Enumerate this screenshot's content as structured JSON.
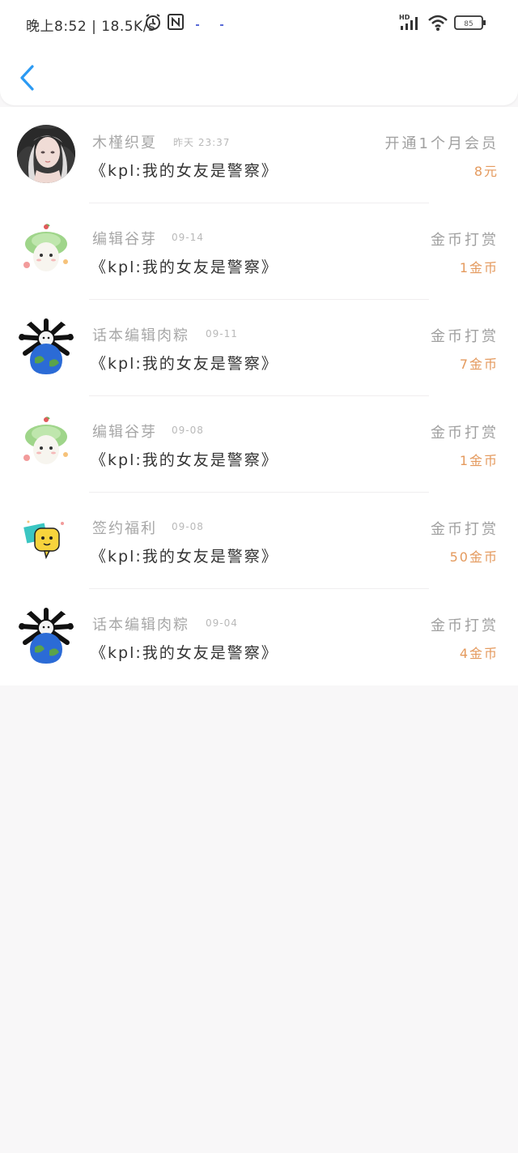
{
  "status_bar": {
    "time_and_speed": "晚上8:52 | 18.5K/s",
    "battery": "85",
    "network": "HD"
  },
  "nav": {
    "back_label": "‹"
  },
  "records": [
    {
      "name": "木槿织夏",
      "date": "昨天 23:37",
      "title": "《kpl:我的女友是警察》",
      "type": "开通1个月会员",
      "amount": "8元",
      "avatar": "portrait"
    },
    {
      "name": "编辑谷芽",
      "date": "09-14",
      "title": "《kpl:我的女友是警察》",
      "type": "金币打赏",
      "amount": "1金币",
      "avatar": "sprout"
    },
    {
      "name": "话本编辑肉粽",
      "date": "09-11",
      "title": "《kpl:我的女友是警察》",
      "type": "金币打赏",
      "amount": "7金币",
      "avatar": "earth"
    },
    {
      "name": "编辑谷芽",
      "date": "09-08",
      "title": "《kpl:我的女友是警察》",
      "type": "金币打赏",
      "amount": "1金币",
      "avatar": "sprout"
    },
    {
      "name": "签约福利",
      "date": "09-08",
      "title": "《kpl:我的女友是警察》",
      "type": "金币打赏",
      "amount": "50金币",
      "avatar": "chat"
    },
    {
      "name": "话本编辑肉粽",
      "date": "09-04",
      "title": "《kpl:我的女友是警察》",
      "type": "金币打赏",
      "amount": "4金币",
      "avatar": "earth"
    }
  ],
  "colors": {
    "accent": "#2b9af3",
    "amount": "#e49a5e",
    "background": "#f8f7f8"
  }
}
